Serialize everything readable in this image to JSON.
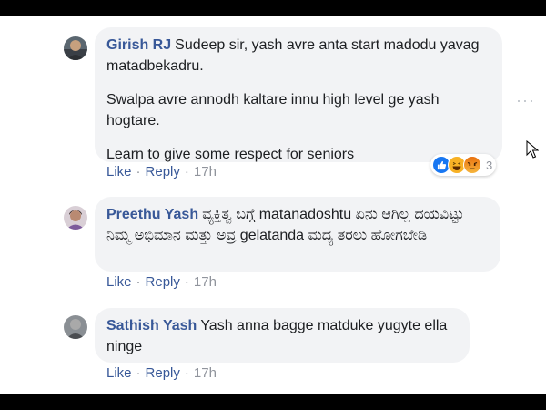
{
  "comments": [
    {
      "author": "Girish RJ",
      "paragraphs": [
        "Sudeep sir, yash avre anta start madodu yavag matadbekadru.",
        "Swalpa avre annodh kaltare innu high level ge yash hogtare.",
        "Learn to give some respect for seniors"
      ],
      "like": "Like",
      "reply": "Reply",
      "time": "17h",
      "reaction_count": "3",
      "reactions": [
        "like-reaction-icon",
        "haha-reaction-icon",
        "angry-reaction-icon"
      ]
    },
    {
      "author": "Preethu Yash",
      "text": "ವ್ಯಕ್ತಿತ್ವ ಬಗ್ಗೆ matanadoshtu ಏನು ಆಗಿಲ್ಲ ದಯವಿಟ್ಟು ನಿಮ್ಮ ಅಭಿಮಾನ ಮತ್ತು ಅವ್ರ gelatanda ಮದ್ಯ ತರಲು ಹೋಗಬೇಡಿ",
      "like": "Like",
      "reply": "Reply",
      "time": "17h"
    },
    {
      "author": "Sathish Yash",
      "text": "Yash anna bagge matduke yugyte ella ninge",
      "like": "Like",
      "reply": "Reply",
      "time": "17h"
    }
  ],
  "more_icon": "···",
  "colors": {
    "author": "#385898",
    "bubble": "#f2f3f5",
    "meta": "#90949c",
    "like": "#1877f2",
    "haha": "#f7b125",
    "angry": "#e9710f"
  }
}
